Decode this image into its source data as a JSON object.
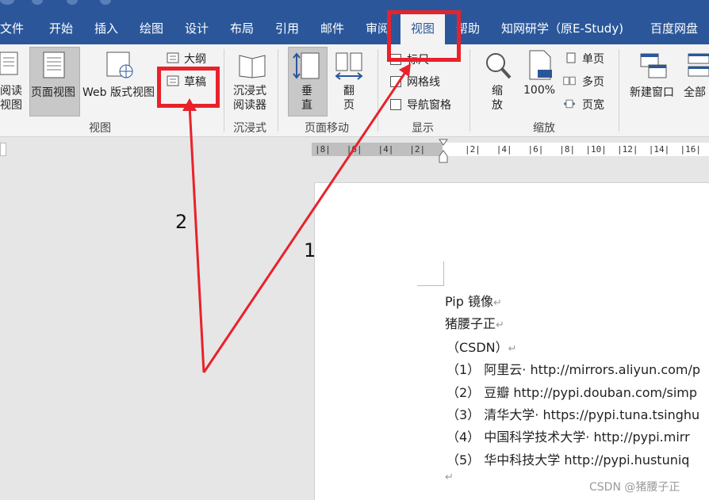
{
  "tabs": [
    {
      "label": "文件"
    },
    {
      "label": "开始"
    },
    {
      "label": "插入"
    },
    {
      "label": "绘图"
    },
    {
      "label": "设计"
    },
    {
      "label": "布局"
    },
    {
      "label": "引用"
    },
    {
      "label": "邮件"
    },
    {
      "label": "审阅"
    },
    {
      "label": "视图",
      "active": true
    },
    {
      "label": "帮助"
    },
    {
      "label": "知网研学（原E-Study)"
    },
    {
      "label": "百度网盘"
    }
  ],
  "ribbon": {
    "views": {
      "read_mode": "阅读\n视图",
      "print_layout": "页面视图",
      "web_layout": "Web 版式视图",
      "outline": "大纲",
      "draft": "草稿",
      "group_label": "视图"
    },
    "immersive": {
      "reader": "沉浸式\n阅读器",
      "group_label": "沉浸式"
    },
    "page_movement": {
      "vertical": "垂\n直",
      "side_to_side": "翻\n页",
      "group_label": "页面移动"
    },
    "show": {
      "ruler": "标尺",
      "gridlines": "网格线",
      "navigation_pane": "导航窗格",
      "group_label": "显示"
    },
    "zoom": {
      "zoom": "缩\n放",
      "hundred": "100%",
      "one_page": "单页",
      "multiple_pages": "多页",
      "page_width": "页宽",
      "group_label": "缩放"
    },
    "window": {
      "new_window": "新建窗口",
      "arrange_all": "全部"
    }
  },
  "ruler": {
    "left_ticks": "|8|   |6|   |4|   |2|",
    "right_ticks": "|2|   |4|   |6|   |8|  |10|  |12|  |14|  |16|"
  },
  "document": {
    "lines": [
      "Pip 镜像",
      "猪腰子正",
      "（CSDN）",
      "（1） 阿里云· http://mirrors.aliyun.com/p",
      "（2） 豆瓣 http://pypi.douban.com/simp",
      "（3） 清华大学· https://pypi.tuna.tsinghu",
      "（4） 中国科学技术大学· http://pypi.mirr",
      "（5） 华中科技大学 http://pypi.hustuniq"
    ],
    "paragraph_mark": "↵"
  },
  "annotations": {
    "number_1": "1",
    "number_2": "2"
  },
  "watermark": "CSDN @猪腰子正",
  "colors": {
    "ribbon_blue": "#2b579a",
    "annotation_red": "#e8222b"
  }
}
